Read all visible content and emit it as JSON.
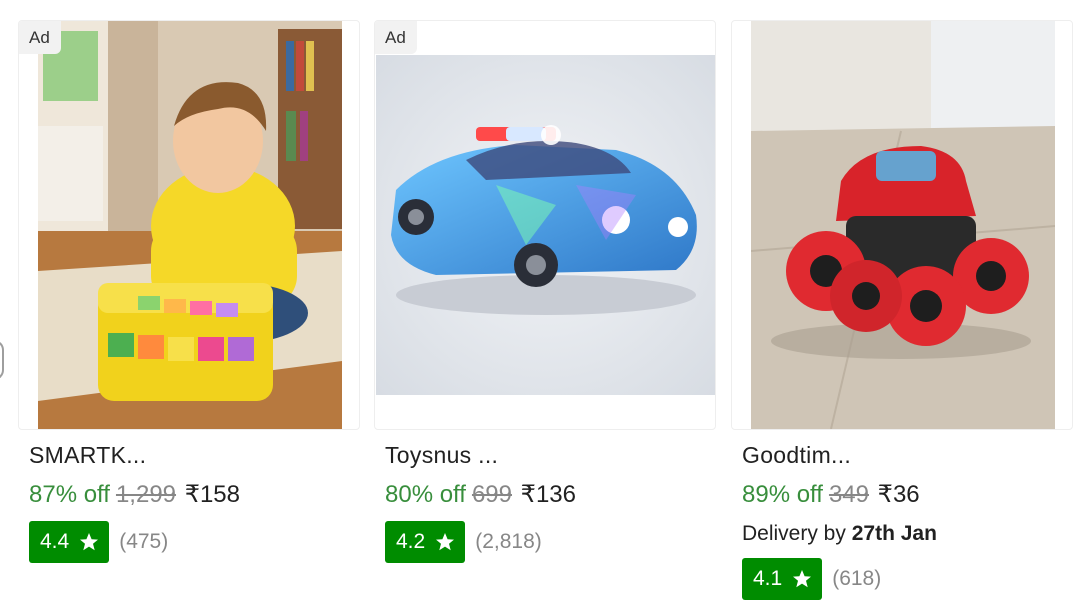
{
  "products": [
    {
      "ad_label": "Ad",
      "title": "SMARTK...",
      "discount": "87% off",
      "mrp": "1,299",
      "price": "₹158",
      "rating": "4.4",
      "rating_count": "(475)",
      "image_icon": "toddler-xylophone-image"
    },
    {
      "ad_label": "Ad",
      "title": "Toysnus ...",
      "discount": "80% off",
      "mrp": "699",
      "price": "₹136",
      "rating": "4.2",
      "rating_count": "(2,818)",
      "image_icon": "led-police-car-image"
    },
    {
      "title": "Goodtim...",
      "discount": "89% off",
      "mrp": "349",
      "price": "₹36",
      "delivery_prefix": "Delivery by",
      "delivery_date": "27th Jan",
      "rating": "4.1",
      "rating_count": "(618)",
      "image_icon": "monster-truck-image"
    }
  ],
  "colors": {
    "discount_green": "#388e3c",
    "rating_green": "#008c00",
    "muted_gray": "#878787",
    "text_dark": "#212121"
  }
}
